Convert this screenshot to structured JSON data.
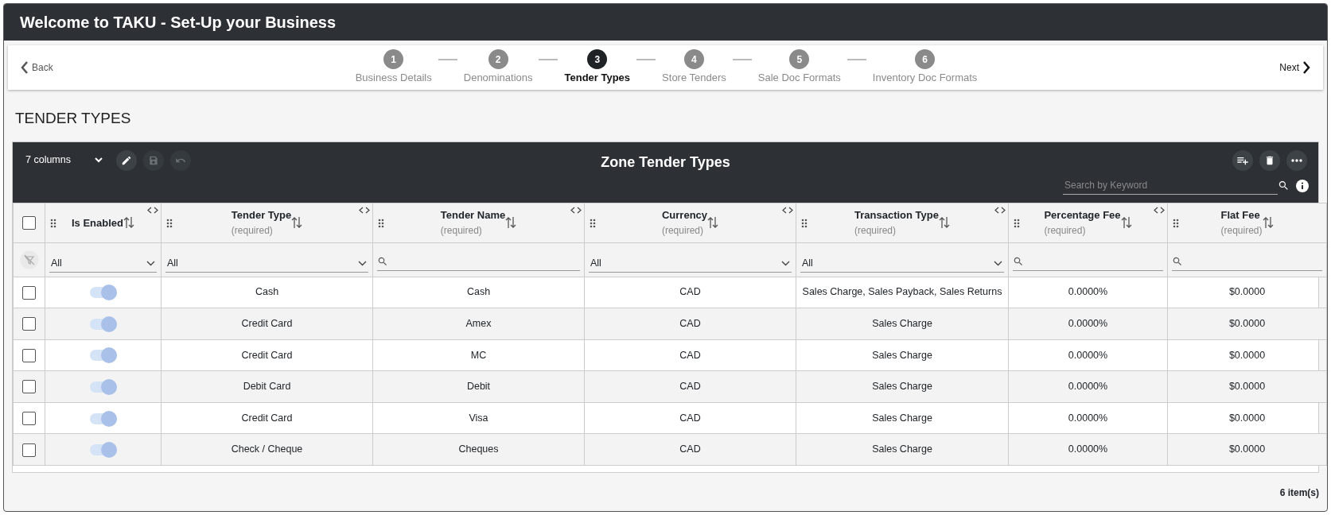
{
  "app_bar": {
    "title": "Welcome to TAKU - Set-Up your Business"
  },
  "stepper": {
    "back": "Back",
    "next": "Next",
    "steps": [
      {
        "number": "1",
        "label": "Business Details",
        "selected": false
      },
      {
        "number": "2",
        "label": "Denominations",
        "selected": false
      },
      {
        "number": "3",
        "label": "Tender Types",
        "selected": true
      },
      {
        "number": "4",
        "label": "Store Tenders",
        "selected": false
      },
      {
        "number": "5",
        "label": "Sale Doc Formats",
        "selected": false
      },
      {
        "number": "6",
        "label": "Inventory Doc Formats",
        "selected": false
      }
    ]
  },
  "section_title": "TENDER TYPES",
  "grid": {
    "columns_menu": "7 columns",
    "title": "Zone Tender Types",
    "search": {
      "placeholder": "Search by Keyword"
    },
    "select_all": {
      "checked": false
    },
    "columns": [
      {
        "label": "Is Enabled",
        "filter": {
          "kind": "select",
          "value": "All"
        },
        "kind": "toggle"
      },
      {
        "label": "Tender Type",
        "note": "(required)",
        "filter": {
          "kind": "select",
          "value": "All"
        },
        "kind": "text"
      },
      {
        "label": "Tender Name",
        "note": "(required)",
        "filter": {
          "kind": "search"
        },
        "kind": "text"
      },
      {
        "label": "Currency",
        "note": "(required)",
        "filter": {
          "kind": "select",
          "value": "All"
        },
        "kind": "text"
      },
      {
        "label": "Transaction Type",
        "note": "(required)",
        "filter": {
          "kind": "select",
          "value": "All"
        },
        "kind": "text"
      },
      {
        "label": "Percentage Fee",
        "note": "(required)",
        "filter": {
          "kind": "search"
        },
        "kind": "text"
      },
      {
        "label": "Flat Fee",
        "note": "(required)",
        "filter": {
          "kind": "search"
        },
        "kind": "text"
      }
    ],
    "rows": [
      {
        "checked": false,
        "cells": [
          {
            "on": true
          },
          "Cash",
          "Cash",
          "CAD",
          "Sales Charge, Sales Payback, Sales Returns",
          "0.0000%",
          "$0.0000"
        ]
      },
      {
        "checked": false,
        "cells": [
          {
            "on": true
          },
          "Credit Card",
          "Amex",
          "CAD",
          "Sales Charge",
          "0.0000%",
          "$0.0000"
        ]
      },
      {
        "checked": false,
        "cells": [
          {
            "on": true
          },
          "Credit Card",
          "MC",
          "CAD",
          "Sales Charge",
          "0.0000%",
          "$0.0000"
        ]
      },
      {
        "checked": false,
        "cells": [
          {
            "on": true
          },
          "Debit Card",
          "Debit",
          "CAD",
          "Sales Charge",
          "0.0000%",
          "$0.0000"
        ]
      },
      {
        "checked": false,
        "cells": [
          {
            "on": true
          },
          "Credit Card",
          "Visa",
          "CAD",
          "Sales Charge",
          "0.0000%",
          "$0.0000"
        ]
      },
      {
        "checked": false,
        "cells": [
          {
            "on": true
          },
          "Check / Cheque",
          "Cheques",
          "CAD",
          "Sales Charge",
          "0.0000%",
          "$0.0000"
        ]
      }
    ],
    "footer": "6 item(s)"
  }
}
